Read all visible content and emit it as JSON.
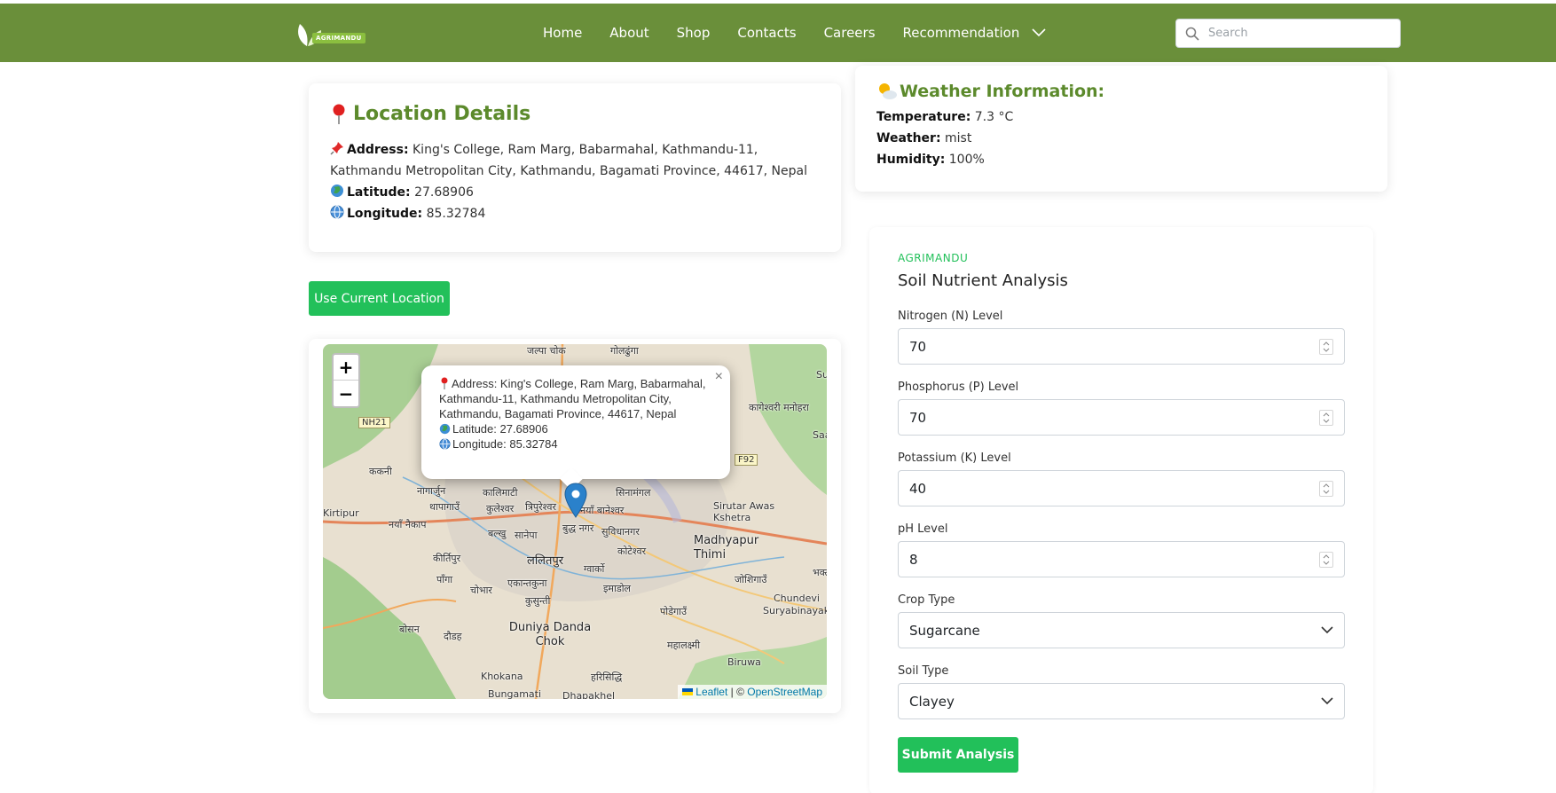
{
  "header": {
    "logo_text": "AGRIMANDU",
    "nav": [
      "Home",
      "About",
      "Shop",
      "Contacts",
      "Careers"
    ],
    "nav_dropdown": "Recommendation",
    "search_placeholder": "Search"
  },
  "location": {
    "title": "Location Details",
    "address_label": "Address:",
    "address": "King's College, Ram Marg, Babarmahal, Kathmandu-11, Kathmandu Metropolitan City, Kathmandu, Bagamati Province, 44617, Nepal",
    "latitude_label": "Latitude:",
    "latitude": "27.68906",
    "longitude_label": "Longitude:",
    "longitude": "85.32784",
    "button": "Use Current Location"
  },
  "weather": {
    "title": "Weather Information:",
    "temperature_label": "Temperature:",
    "temperature": "7.3 °C",
    "weather_label": "Weather:",
    "weather": "mist",
    "humidity_label": "Humidity:",
    "humidity": "100%"
  },
  "map": {
    "zoom_in": "+",
    "zoom_out": "−",
    "popup": {
      "address": "Address: King's College, Ram Marg, Babarmahal, Kathmandu-11, Kathmandu Metropolitan City, Kathmandu, Bagamati Province, 44617, Nepal",
      "latitude": "Latitude: 27.68906",
      "longitude": "Longitude: 85.32784",
      "close": "×"
    },
    "labels": [
      "जल्पा चोक",
      "गोलढुंगा",
      "NH21",
      "कागेश्वरी मनोहरा",
      "F92",
      "ककनी",
      "नागार्जुन",
      "थापागाउँ",
      "कालिमाटी",
      "कुलेश्वर",
      "त्रिपुरेश्वर",
      "सिनामंगल",
      "नयाँ बानेश्वर",
      "नयाँ नैकाप",
      "बल्खु",
      "सानेपा",
      "बुद्ध नगर",
      "सुविधानगर",
      "Sirutar Awas Kshetra",
      "Madhyapur Thimi",
      "कीर्तिपुर",
      "ललितपुर",
      "कोटेश्वर",
      "पाँगा",
      "चोभार",
      "एकान्तकुना",
      "ग्वार्को",
      "इमाडोल",
      "जोशिगाउँ",
      "कुसुन्ती",
      "Chundevi",
      "पोडेगाउँ",
      "Suryabinayak",
      "बोसन",
      "दौडह",
      "Duniya Danda Chok",
      "महालक्ष्मी",
      "Biruwa",
      "Khokana",
      "हरिसिद्धि",
      "Bungamati",
      "Dhapakhel",
      "Saa",
      "भक्त",
      "Su",
      "Kirtipur"
    ],
    "attrib_leaflet": "Leaflet",
    "attrib_sep": "| ©",
    "attrib_osm": "OpenStreetMap"
  },
  "soil": {
    "brand": "AGRIMANDU",
    "title": "Soil Nutrient Analysis",
    "fields": [
      {
        "label": "Nitrogen (N) Level",
        "value": "70"
      },
      {
        "label": "Phosphorus (P) Level",
        "value": "70"
      },
      {
        "label": "Potassium (K) Level",
        "value": "40"
      },
      {
        "label": "pH Level",
        "value": "8"
      }
    ],
    "crop_label": "Crop Type",
    "crop_value": "Sugarcane",
    "soil_label": "Soil Type",
    "soil_value": "Clayey",
    "submit": "Submit Analysis"
  },
  "colors": {
    "nav_bg": "#6a8f3a",
    "title_green": "#5c8a2c",
    "button_green": "#22c05a"
  }
}
